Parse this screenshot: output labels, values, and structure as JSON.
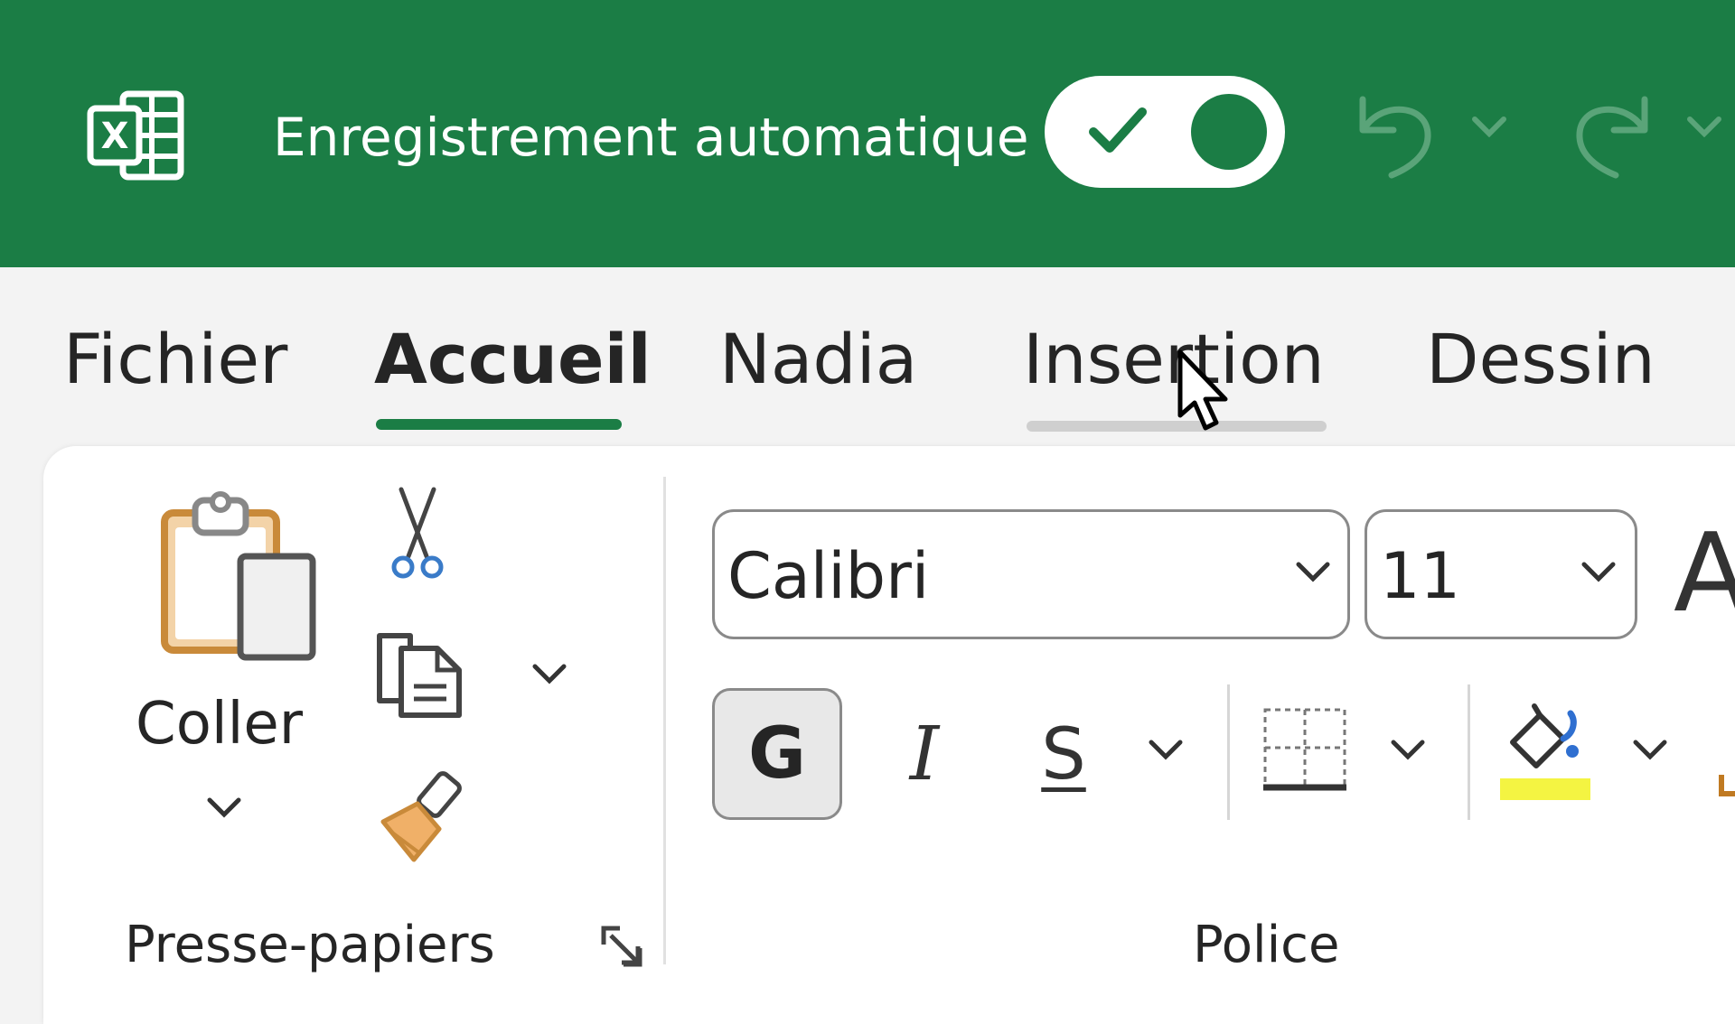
{
  "app": {
    "autosave_label": "Enregistrement automatique",
    "autosave_on": true,
    "logo_letter": "X"
  },
  "tabs": [
    {
      "label": "Fichier",
      "active": false
    },
    {
      "label": "Accueil",
      "active": true
    },
    {
      "label": "Nadia",
      "active": false
    },
    {
      "label": "Insertion",
      "active": false,
      "hovered": true
    },
    {
      "label": "Dessin",
      "active": false
    }
  ],
  "clipboard": {
    "paste_label": "Coller",
    "group_label": "Presse-papiers"
  },
  "font": {
    "family_value": "Calibri",
    "size_value": "11",
    "grow_font_glyph": "A",
    "bold_label": "G",
    "italic_label": "I",
    "underline_label": "S",
    "group_label": "Police"
  },
  "icons": {
    "logo": "excel-logo-icon",
    "undo": "undo-icon",
    "redo": "redo-icon",
    "paste": "clipboard-icon",
    "cut": "scissors-icon",
    "copy": "copy-icon",
    "painter": "format-painter-icon",
    "borders": "borders-icon",
    "fill": "fill-color-icon",
    "launcher": "dialog-launcher-icon",
    "cursor": "mouse-pointer-icon"
  },
  "colors": {
    "brand": "#1b7d45",
    "fill_color": "#f4f442"
  }
}
